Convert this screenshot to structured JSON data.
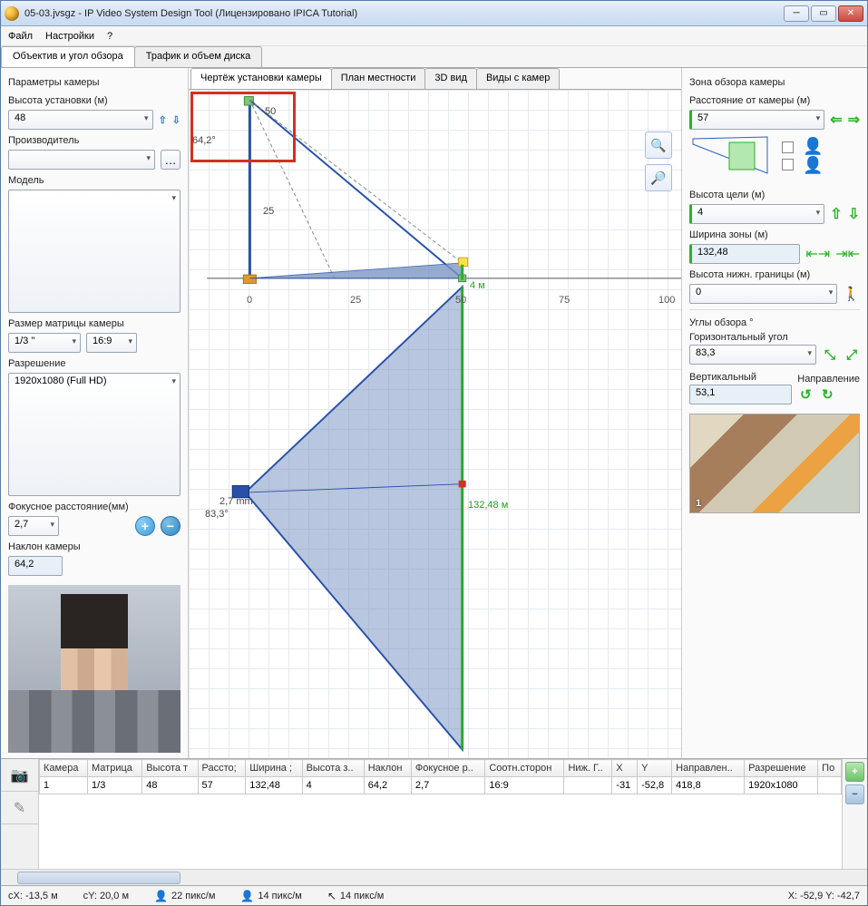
{
  "window": {
    "title": "05-03.jvsgz - IP Video System Design Tool (Лицензировано  IPICA Tutorial)"
  },
  "menu": {
    "file": "Файл",
    "settings": "Настройки",
    "help": "?"
  },
  "mainTabs": {
    "lens": "Объектив и угол обзора",
    "traffic": "Трафик и объем диска"
  },
  "left": {
    "paramsTitle": "Параметры камеры",
    "heightLbl": "Высота установки (м)",
    "height": "48",
    "manufLbl": "Производитель",
    "manuf": "",
    "modelLbl": "Модель",
    "model": "",
    "sensorLbl": "Размер матрицы камеры",
    "sensor": "1/3 \"",
    "aspect": "16:9",
    "resLbl": "Разрешение",
    "res": "1920x1080 (Full HD)",
    "focalLbl": "Фокусное расстояние(мм)",
    "focal": "2,7",
    "tiltLbl": "Наклон камеры",
    "tilt": "64,2"
  },
  "viewTabs": {
    "drawing": "Чертёж установки камеры",
    "plan": "План местности",
    "v3d": "3D вид",
    "views": "Виды с камер"
  },
  "canvas": {
    "angleLabel": "64,2°",
    "heightLabel": "50",
    "depthLabel": "25",
    "axis": {
      "x0": "0",
      "x25": "25",
      "x50": "50",
      "x75": "75",
      "x100": "100"
    },
    "topAngleFocal": "2,7 mm",
    "topAngleVal": "83,3°",
    "widthLabel": "132,48 м",
    "targetH": "4 м"
  },
  "right": {
    "zoneTitle": "Зона обзора камеры",
    "distLbl": "Расстояние от камеры (м)",
    "dist": "57",
    "tgtHLbl": "Высота цели (м)",
    "tgtH": "4",
    "zoneWLbl": "Ширина зоны (м)",
    "zoneW": "132,48",
    "lowHLbl": "Высота нижн. границы (м)",
    "lowH": "0",
    "anglesTitle": "Углы обзора °",
    "hAngLbl": "Горизонтальный угол",
    "hAng": "83,3",
    "vAngLbl": "Вертикальный",
    "vAng": "53,1",
    "dirLbl": "Направление",
    "minimapIdx": "1"
  },
  "table": {
    "headers": {
      "cam": "Камера",
      "mat": "Матрица",
      "h": "Высота т",
      "dist": "Рассто;",
      "zw": "Ширина ;",
      "zh": "Высота з..",
      "tilt": "Наклон",
      "focal": "Фокусное р..",
      "aspect": "Соотн.сторон",
      "low": "Ниж. Г..",
      "x": "X",
      "y": "Y",
      "dir": "Направлен..",
      "res": "Разрешение",
      "po": "По"
    },
    "row": {
      "cam": "1",
      "mat": "1/3",
      "h": "48",
      "dist": "57",
      "zw": "132,48",
      "zh": "4",
      "tilt": "64,2",
      "focal": "2,7",
      "aspect": "16:9",
      "low": "",
      "x": "-31",
      "y": "-52,8",
      "dir": "418,8",
      "res": "1920x1080",
      "po": ""
    }
  },
  "status": {
    "cx": "cX: -13,5 м",
    "cy": "cY: 20,0 м",
    "px1": "22 пикс/м",
    "px2": "14 пикс/м",
    "px3": "14 пикс/м",
    "xy": "X: -52,9 Y: -42,7"
  }
}
